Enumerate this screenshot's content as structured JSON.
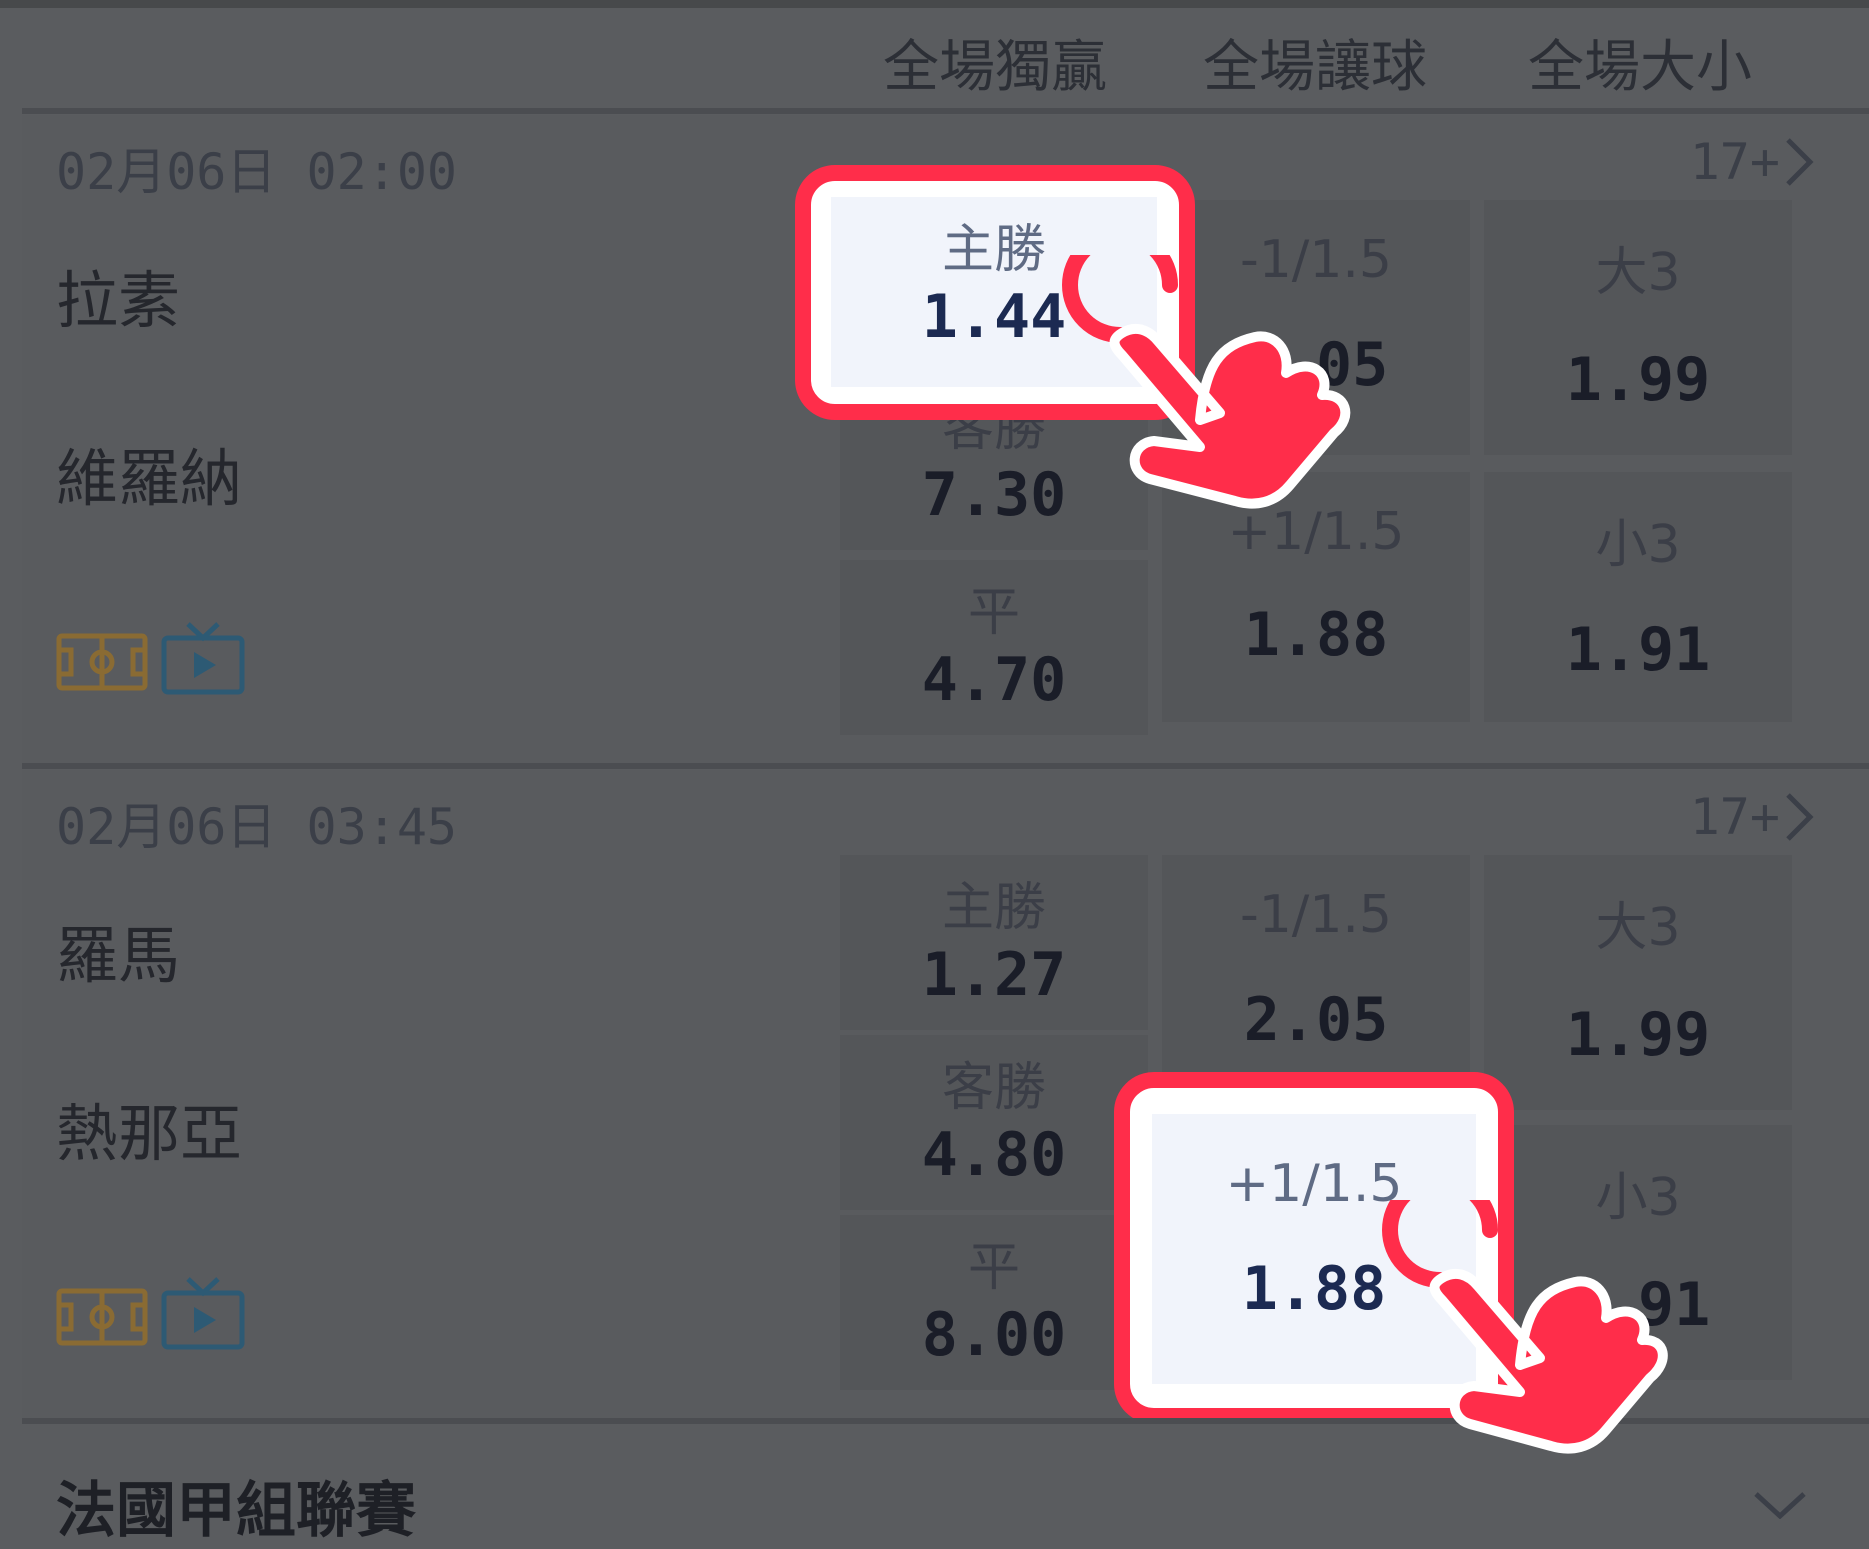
{
  "columns": [
    "全場獨贏",
    "全場讓球",
    "全場大小"
  ],
  "matches": [
    {
      "datetime": "02月06日 02:00",
      "more": "17+",
      "home": "拉素",
      "away": "維羅納",
      "win": [
        {
          "label": "主勝",
          "value": "1.44"
        },
        {
          "label": "客勝",
          "value": "7.30"
        },
        {
          "label": "平",
          "value": "4.70"
        }
      ],
      "handicap": [
        {
          "label": "-1/1.5",
          "value": "2.05"
        },
        {
          "label": "+1/1.5",
          "value": "1.88"
        }
      ],
      "total": [
        {
          "label": "大3",
          "value": "1.99"
        },
        {
          "label": "小3",
          "value": "1.91"
        }
      ]
    },
    {
      "datetime": "02月06日 03:45",
      "more": "17+",
      "home": "羅馬",
      "away": "熱那亞",
      "win": [
        {
          "label": "主勝",
          "value": "1.27"
        },
        {
          "label": "客勝",
          "value": "4.80"
        },
        {
          "label": "平",
          "value": "8.00"
        }
      ],
      "handicap": [
        {
          "label": "-1/1.5",
          "value": "2.05"
        },
        {
          "label": "+1/1.5",
          "value": "1.88"
        }
      ],
      "total": [
        {
          "label": "大3",
          "value": "1.99"
        },
        {
          "label": "小3",
          "value": "1.91"
        }
      ]
    }
  ],
  "league": {
    "name": "法國甲組聯賽"
  },
  "icons": {
    "field": "soccer-field-icon",
    "tv": "tv-play-icon",
    "chevron_right": "chevron-right-icon",
    "chevron_down": "chevron-down-icon",
    "hand": "tap-hand-icon"
  },
  "colors": {
    "highlight_border": "#ff2d4a",
    "overlay": "#5a5c5f",
    "odds_text": "#1a1d28",
    "field_icon": "#8a6b33",
    "tv_icon": "#2d5a74"
  }
}
